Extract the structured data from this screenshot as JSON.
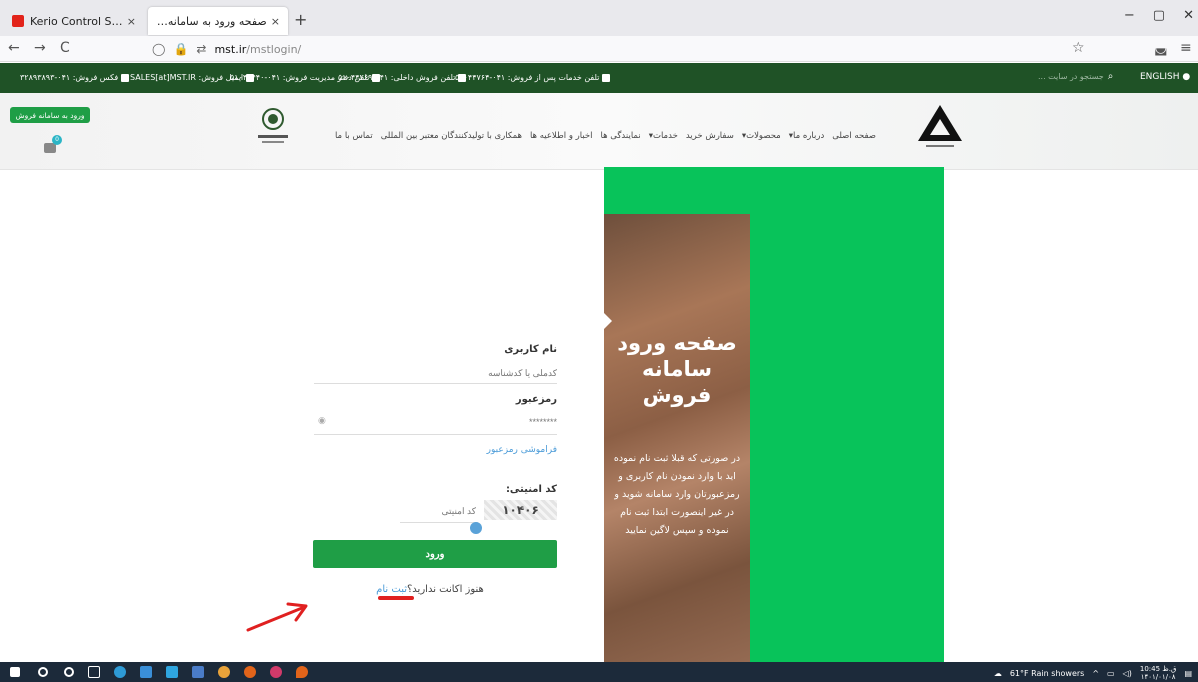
{
  "browser": {
    "tabs": [
      {
        "title": "Kerio Control Statistics"
      },
      {
        "title": "صفحه ورود به سامانه فروش محصولات"
      }
    ],
    "url": {
      "host": "mst.ir",
      "path": "/mstlogin/"
    },
    "controls": {
      "back": "←",
      "forward": "→",
      "reload": "C",
      "new_tab": "+",
      "close": "×",
      "minimize": "−",
      "maximize": "▢",
      "exit": "✕"
    },
    "star": "☆",
    "shield": "◛",
    "menu": "≡"
  },
  "contact_bar": {
    "items": [
      "تلفن خدمات پس از فروش: ۰۴۱-۵۱۰۴۴۷۶۴",
      "تلفن فروش داخلی: ۰۴۱-۵۱۰۴۴۲۶۹",
      "تلفن دفتر مدیریت فروش: ۰۴۱-۵۱۰۴۴۴۴۰",
      "ایمیل فروش: SALES[at]MST.IR",
      "فکس فروش: ۰۴۱-۳۲۸۹۳۸۹۳"
    ],
    "search_placeholder": "جستجو در سایت ...",
    "language": "ENGLISH"
  },
  "header": {
    "login_button": "ورود به سامانه فروش",
    "cart_count": "0",
    "menu": [
      "صفحه اصلی",
      "درباره ما▾",
      "محصولات▾",
      "سفارش خرید",
      "خدمات▾",
      "نمایندگی ها",
      "اخبار و اطلاعیه ها",
      "همکاری با تولیدکنندگان معتبر بین المللی",
      "تماس با ما"
    ]
  },
  "panel": {
    "title": "صفحه ورود سامانه فروش",
    "description": "در صورتی که قبلا ثبت نام نموده اید با وارد نمودن نام کاربری و رمزعبورتان وارد سامانه شوید و در غیر اینصورت ابتدا ثبت نام نموده و سپس لاگین نمایید"
  },
  "form": {
    "username_label": "نام کاربری",
    "username_placeholder": "کدملی یا کدشناسه",
    "password_label": "رمزعبور",
    "password_placeholder": "********",
    "forgot": "فراموشی رمزعبور",
    "captcha_label": "کد امنیتی:",
    "captcha_placeholder": "کد امنیتی",
    "captcha_code": "۱۰۴۰۶",
    "submit": "ورود",
    "signup_prompt": "هنوز اکانت ندارید؟",
    "signup_link": "ثبت نام"
  },
  "taskbar": {
    "weather": "61°F Rain showers",
    "time": "10:45 ق.ظ",
    "date": "۱۴۰۱/۰۱/۰۸"
  },
  "colors": {
    "brand_green": "#1f5226",
    "accent_green": "#08c35a",
    "button_green": "#1f9e46",
    "link": "#4a9bd8"
  }
}
